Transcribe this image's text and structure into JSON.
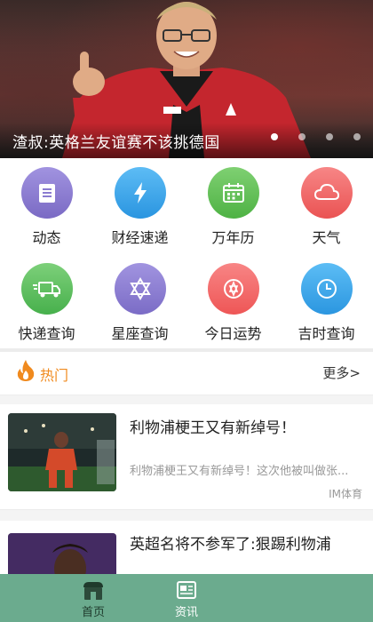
{
  "banner": {
    "caption": "渣叔:英格兰友谊赛不该挑德国",
    "slide_count": 4,
    "active_slide": 1
  },
  "grid": {
    "items": [
      {
        "label": "动态",
        "icon": "document-icon",
        "color": "#8d7fd0"
      },
      {
        "label": "财经速递",
        "icon": "lightning-icon",
        "color": "#3aa7ec"
      },
      {
        "label": "万年历",
        "icon": "calendar-icon",
        "color": "#62c05a"
      },
      {
        "label": "天气",
        "icon": "cloud-icon",
        "color": "#f06464"
      },
      {
        "label": "快递查询",
        "icon": "truck-icon",
        "color": "#5cc163"
      },
      {
        "label": "星座查询",
        "icon": "star-icon",
        "color": "#8f7fd2"
      },
      {
        "label": "今日运势",
        "icon": "fortune-icon",
        "color": "#f36a6a"
      },
      {
        "label": "吉时查询",
        "icon": "clock-icon",
        "color": "#3aa6ec"
      }
    ]
  },
  "hot": {
    "title": "热门",
    "more": "更多>",
    "accent": "#f08a1e"
  },
  "news": [
    {
      "title": "利物浦梗王又有新绰号！",
      "snippet": "利物浦梗王又有新绰号！这次他被叫做张...",
      "source": "IM体育"
    },
    {
      "title": "英超名将不参军了:狠踢利物浦",
      "snippet": "",
      "source": ""
    }
  ],
  "bottom_nav": {
    "background": "#6bab8e",
    "items": [
      {
        "label": "首页",
        "icon": "home-icon",
        "active": true
      },
      {
        "label": "资讯",
        "icon": "news-icon",
        "active": false
      }
    ]
  }
}
